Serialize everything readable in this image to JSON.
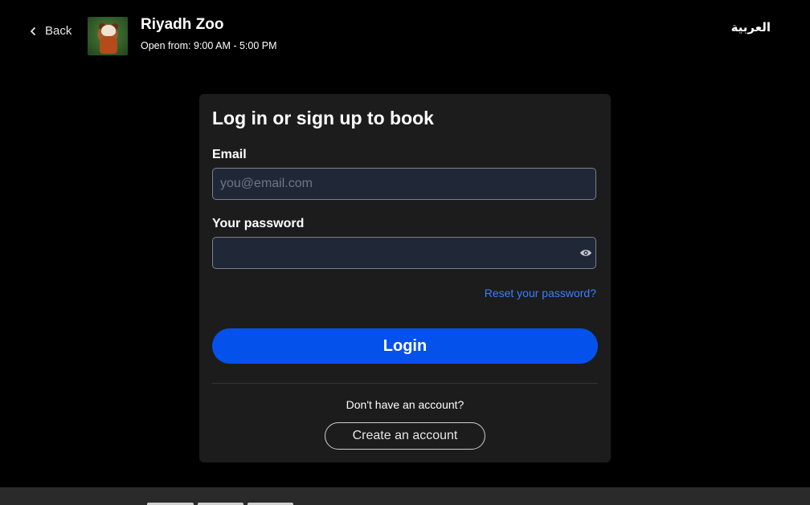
{
  "header": {
    "back_label": "Back",
    "title": "Riyadh Zoo",
    "hours": "Open from: 9:00 AM - 5:00 PM",
    "language_toggle": "العربية",
    "avatar_icon": "red-panda-photo"
  },
  "login_card": {
    "heading": "Log in or sign up to book",
    "email_label": "Email",
    "email_placeholder": "you@email.com",
    "email_value": "",
    "password_label": "Your password",
    "password_value": "",
    "password_toggle_icon": "eye-icon",
    "reset_link": "Reset your password?",
    "login_button": "Login",
    "no_account_text": "Don't have an account?",
    "create_account_button": "Create an account"
  },
  "colors": {
    "background": "#000000",
    "card": "#1c1c1c",
    "input_bg": "#202838",
    "primary": "#0551ec",
    "link": "#3d7dff"
  }
}
